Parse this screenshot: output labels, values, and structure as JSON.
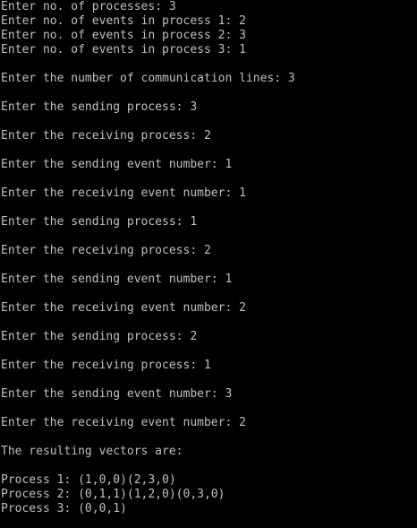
{
  "console": {
    "lines": [
      "Enter no. of processes: 3",
      "Enter no. of events in process 1: 2",
      "Enter no. of events in process 2: 3",
      "Enter no. of events in process 3: 1",
      "",
      "Enter the number of communication lines: 3",
      "",
      "Enter the sending process: 3",
      "",
      "Enter the receiving process: 2",
      "",
      "Enter the sending event number: 1",
      "",
      "Enter the receiving event number: 1",
      "",
      "Enter the sending process: 1",
      "",
      "Enter the receiving process: 2",
      "",
      "Enter the sending event number: 1",
      "",
      "Enter the receiving event number: 2",
      "",
      "Enter the sending process: 2",
      "",
      "Enter the receiving process: 1",
      "",
      "Enter the sending event number: 3",
      "",
      "Enter the receiving event number: 2",
      "",
      "The resulting vectors are:",
      "",
      "Process 1: (1,0,0)(2,3,0)",
      "Process 2: (0,1,1)(1,2,0)(0,3,0)",
      "Process 3: (0,0,1)"
    ]
  }
}
